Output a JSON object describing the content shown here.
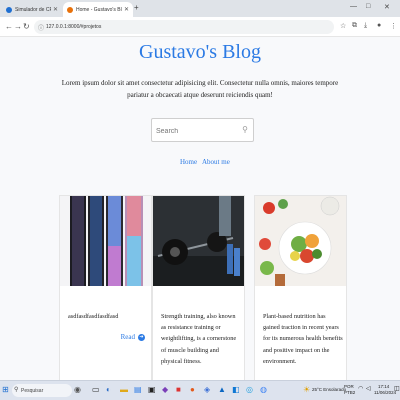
{
  "browser": {
    "tabs": [
      {
        "label": "Simulador de CPF - 4Devs",
        "active": false,
        "favicon_color": "#1f6fd1"
      },
      {
        "label": "Home - Gustavo's Blog",
        "active": true,
        "favicon_color": "#e8710a"
      }
    ],
    "new_tab_symbol": "+",
    "url": "127.0.0.1:8000/#projetos",
    "window_controls": [
      "—",
      "□",
      "✕"
    ]
  },
  "page": {
    "title": "Gustavo's Blog",
    "intro": "Lorem ipsum dolor sit amet consectetur adipisicing elit. Consectetur nulla omnis, maiores tempore pariatur a obcaecati atque deserunt reiciendis quam!",
    "search": {
      "placeholder": "Search"
    },
    "nav": [
      {
        "label": "Home"
      },
      {
        "label": "About me"
      }
    ],
    "cards": [
      {
        "image": "smartphones-photo",
        "text": "asdfasdfasdfasdfasd",
        "read_label": "Read"
      },
      {
        "image": "barbell-gym-photo",
        "text": "Strength training, also known as resistance training or weightlifting, is a cornerstone of muscle building and physical fitness."
      },
      {
        "image": "healthy-food-bowls-photo",
        "text": "Plant-based nutrition has gained traction in recent years for its numerous health benefits and positive impact on the environment."
      }
    ]
  },
  "taskbar": {
    "search_label": "Pesquisar",
    "weather": "25°C Ensolarado",
    "lang": "POR",
    "lang_sub": "PTB2",
    "time": "17:14",
    "date": "11/06/2024",
    "accent": "#2b7ae4"
  }
}
